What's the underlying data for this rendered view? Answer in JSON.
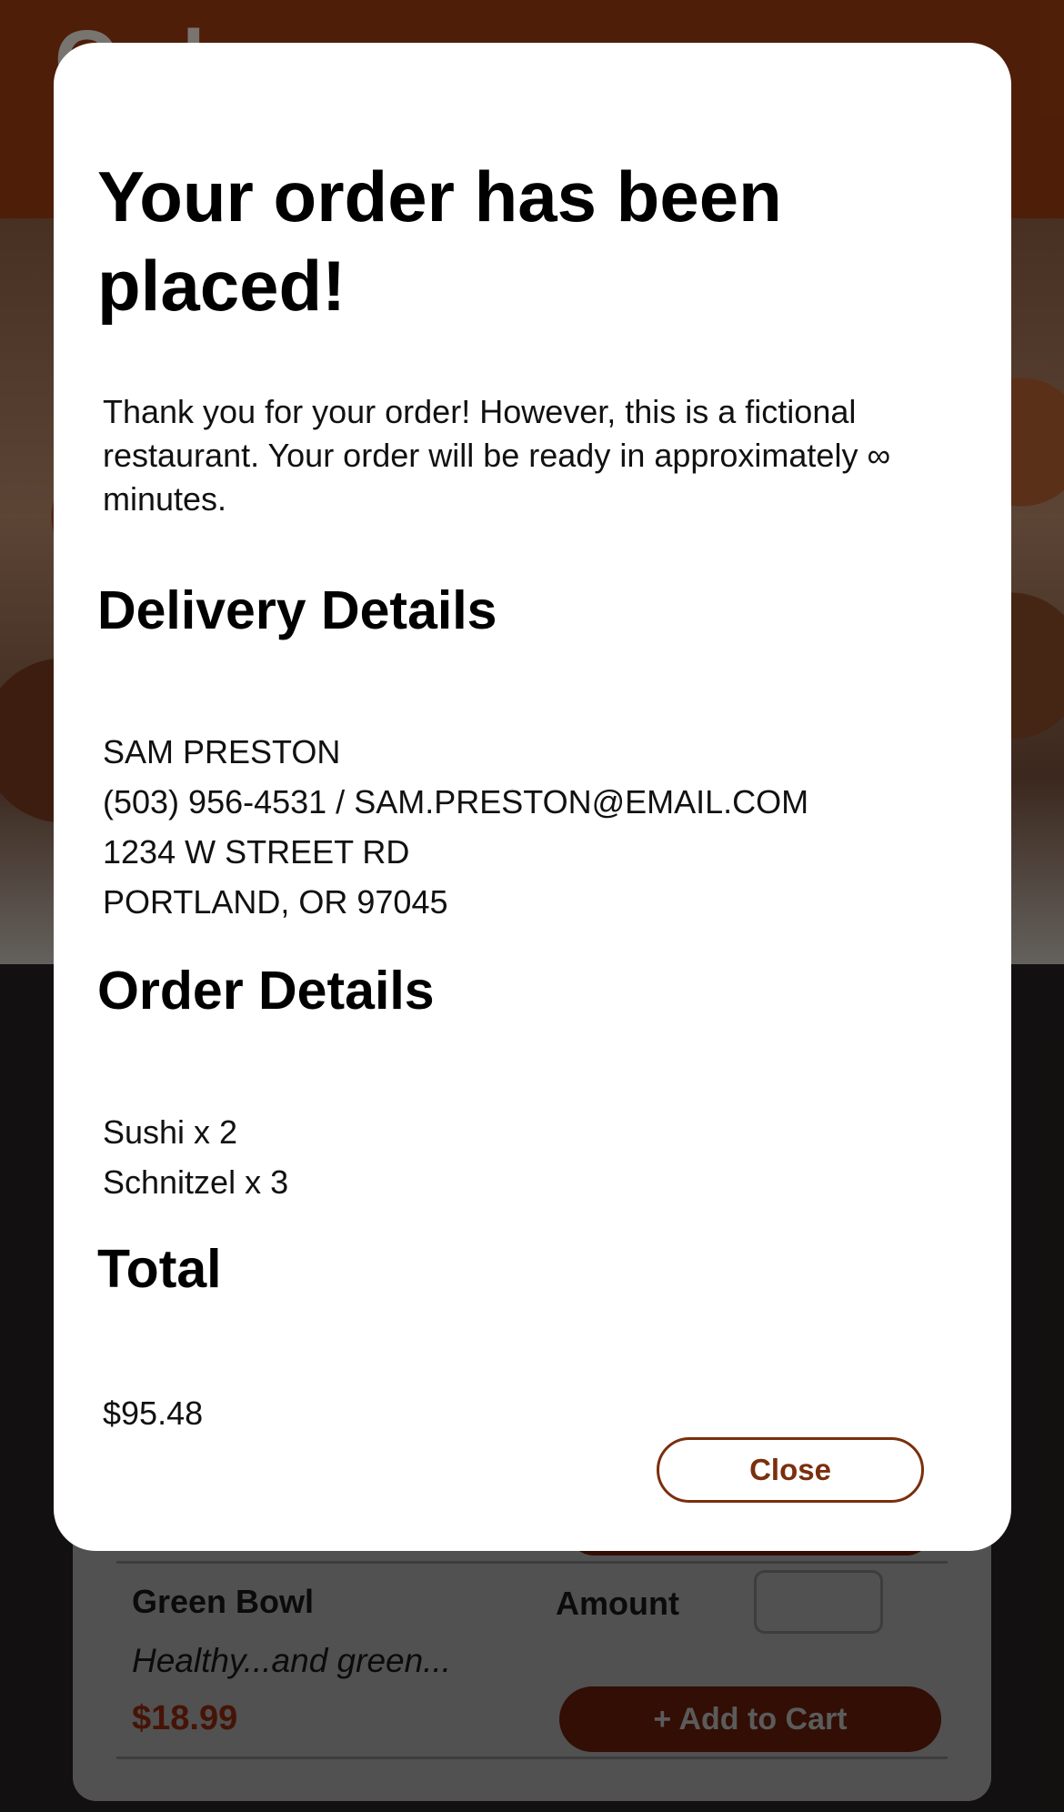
{
  "background": {
    "page_title": "Order",
    "menu_item": {
      "name": "Green Bowl",
      "description": "Healthy...and green...",
      "price": "$18.99",
      "amount_label": "Amount",
      "add_to_cart_label": "+ Add to Cart"
    }
  },
  "modal": {
    "title": "Your order has been placed!",
    "message": "Thank you for your order! However, this is a fictional restaurant. Your order will be ready in approximately ∞ minutes.",
    "delivery": {
      "heading": "Delivery Details",
      "name": "SAM PRESTON",
      "contact": "(503) 956-4531 / SAM.PRESTON@EMAIL.COM",
      "street": "1234 W STREET RD",
      "city": "PORTLAND, OR 97045"
    },
    "order": {
      "heading": "Order Details",
      "items": [
        "Sushi x 2",
        "Schnitzel x 3"
      ]
    },
    "total": {
      "heading": "Total",
      "amount": "$95.48"
    },
    "close_label": "Close"
  },
  "colors": {
    "brand": "#7a2f0d",
    "price": "#6a200a"
  }
}
